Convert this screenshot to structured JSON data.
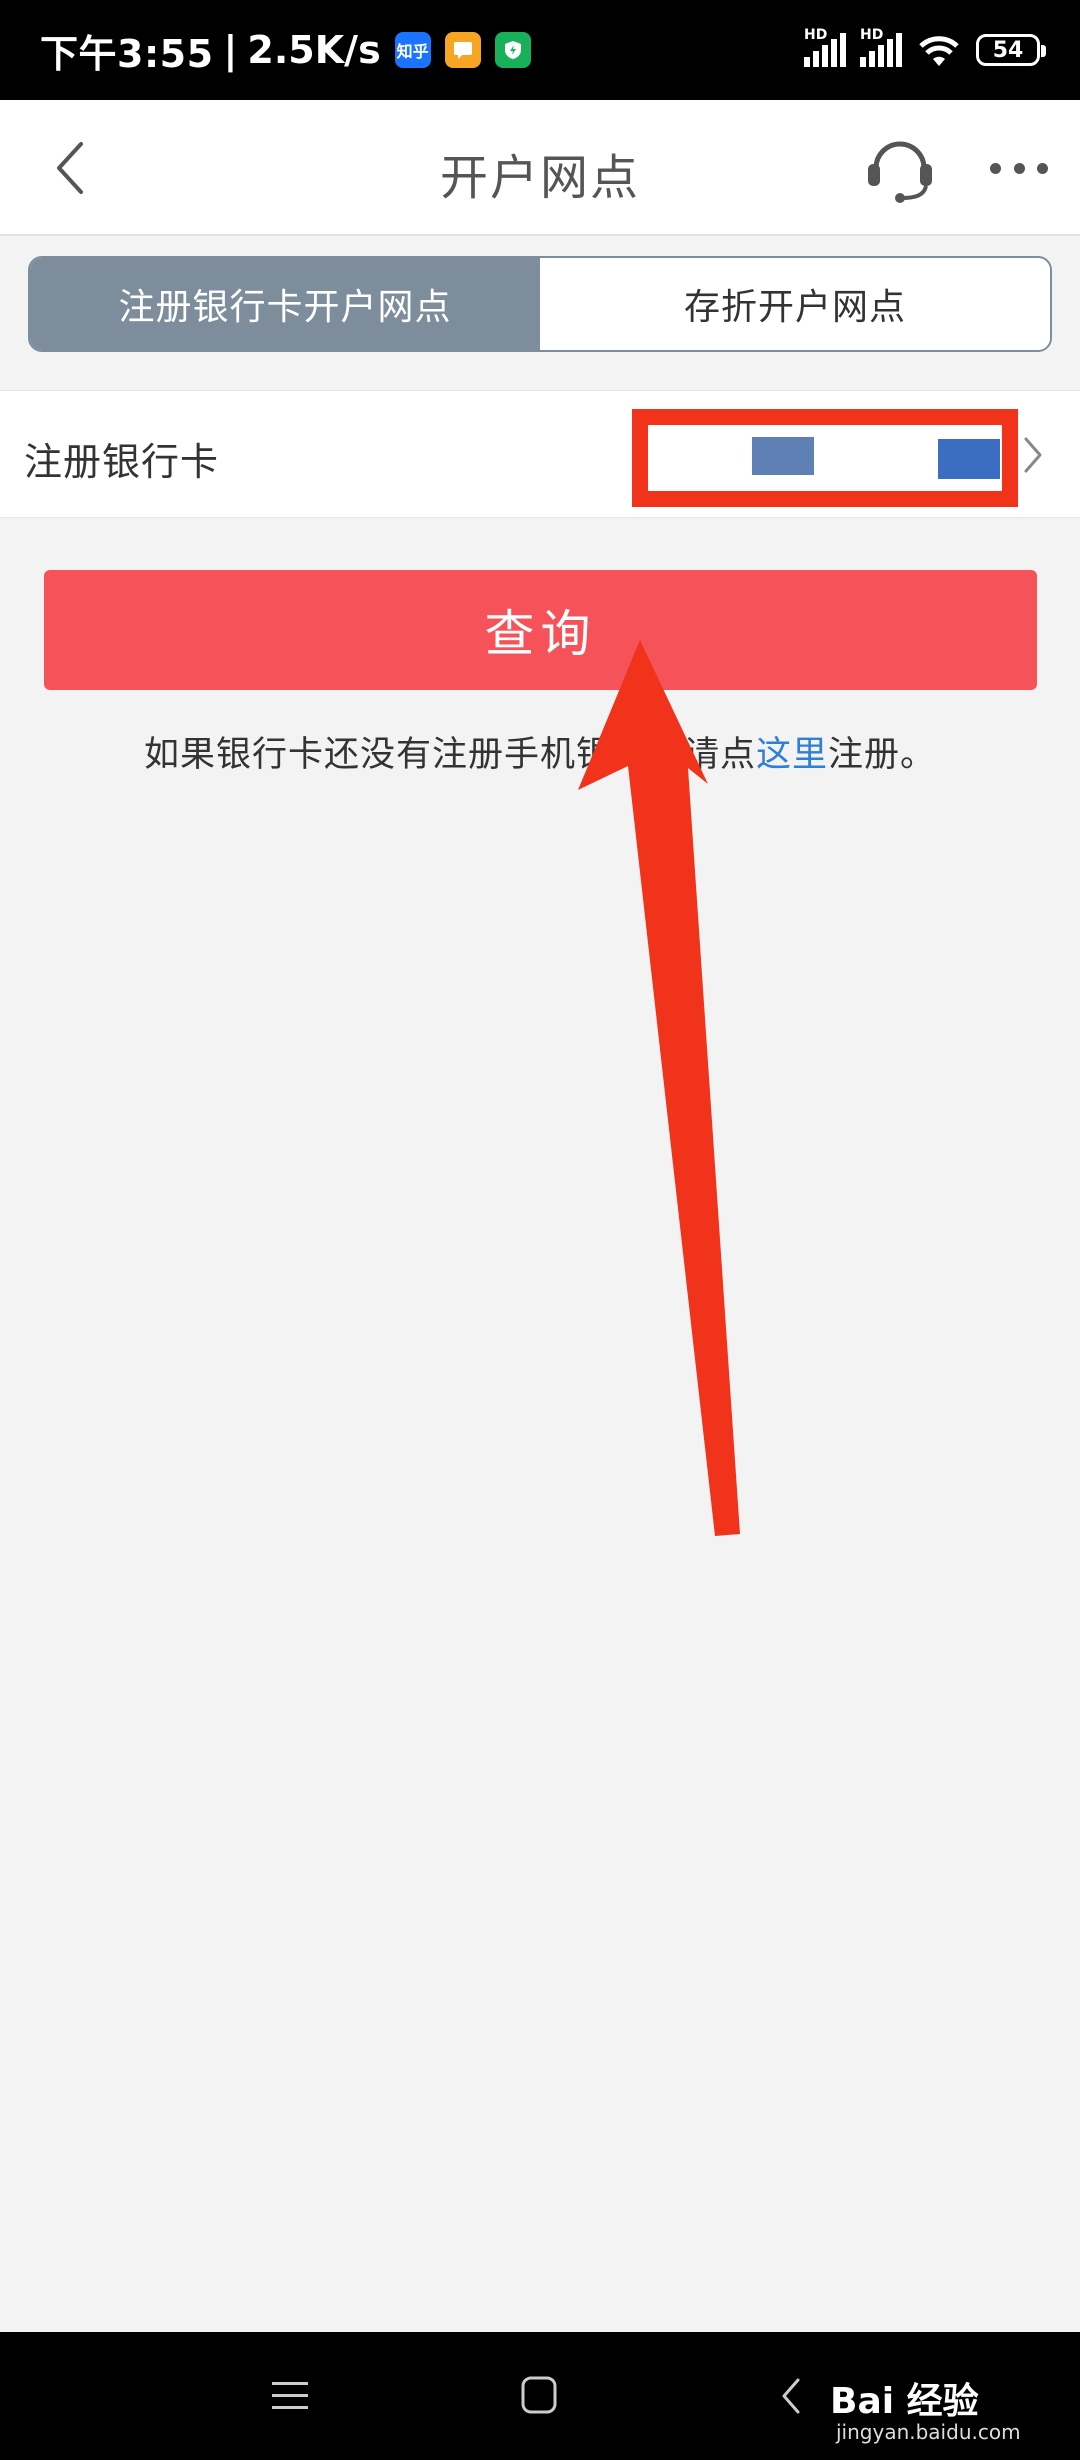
{
  "status_bar": {
    "time": "下午3:55",
    "separator": "|",
    "speed": "2.5K/s",
    "apps": [
      {
        "name": "zhihu-icon",
        "label": "知乎",
        "color": "#1a74ff"
      },
      {
        "name": "message-icon",
        "label": "",
        "color": "#f6a623"
      },
      {
        "name": "shield-icon",
        "label": "",
        "color": "#18b15a"
      }
    ],
    "signal_labels": [
      "HD",
      "HD"
    ],
    "battery": "54"
  },
  "header": {
    "title": "开户网点"
  },
  "tabs": [
    {
      "label": "注册银行卡开户网点",
      "active": true
    },
    {
      "label": "存折开户网点",
      "active": false
    }
  ],
  "card_row": {
    "label": "注册银行卡"
  },
  "query_button": {
    "label": "查询"
  },
  "hint": {
    "before": "如果银行卡还没有注册手机银行，请点",
    "link": "这里",
    "after": "注册。"
  },
  "watermark": {
    "brand": "Bai 经验",
    "url": "jingyan.baidu.com"
  },
  "colors": {
    "tab_active": "#7d8d9b",
    "query_button": "#f5525a",
    "link": "#2f7ed8",
    "annotation": "#f1331c"
  }
}
